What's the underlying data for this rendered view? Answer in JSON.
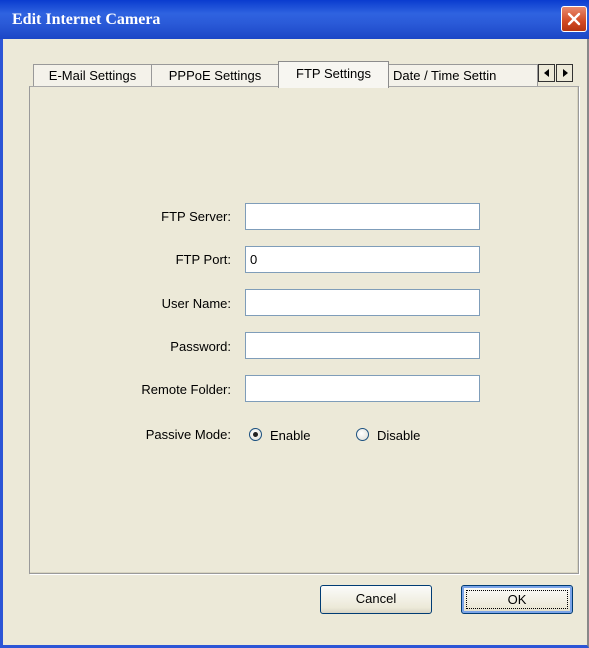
{
  "window": {
    "title": "Edit Internet Camera"
  },
  "tabs": [
    {
      "label": "E-Mail Settings"
    },
    {
      "label": "PPPoE Settings"
    },
    {
      "label": "FTP Settings"
    },
    {
      "label": "Date / Time Settin"
    }
  ],
  "active_tab": "FTP Settings",
  "form": {
    "ftp_server": {
      "label": "FTP Server:",
      "value": ""
    },
    "ftp_port": {
      "label": "FTP Port:",
      "value": "0"
    },
    "user_name": {
      "label": "User Name:",
      "value": ""
    },
    "password": {
      "label": "Password:",
      "value": ""
    },
    "remote_folder": {
      "label": "Remote Folder:",
      "value": ""
    },
    "passive_mode": {
      "label": "Passive Mode:",
      "enable_label": "Enable",
      "disable_label": "Disable",
      "selected": "Enable"
    }
  },
  "buttons": {
    "cancel": "Cancel",
    "ok": "OK"
  },
  "icons": {
    "close": "close-icon",
    "tab_left": "arrow-left-icon",
    "tab_right": "arrow-right-icon"
  },
  "colors": {
    "titlebar": "#2a5ad8",
    "close": "#d24a23",
    "dialog_bg": "#ece9d8"
  }
}
